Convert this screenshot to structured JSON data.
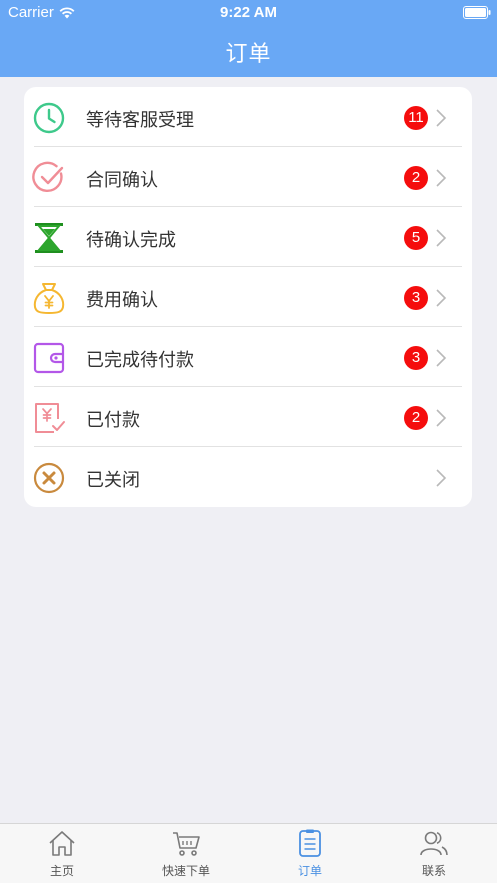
{
  "status_bar": {
    "carrier": "Carrier",
    "time": "9:22 AM"
  },
  "nav": {
    "title": "订单"
  },
  "orders": [
    {
      "label": "等待客服受理",
      "badge": "11",
      "icon": "clock-icon",
      "color": "#3ec98b"
    },
    {
      "label": "合同确认",
      "badge": "2",
      "icon": "check-circle-icon",
      "color": "#f08d96"
    },
    {
      "label": "待确认完成",
      "badge": "5",
      "icon": "hourglass-icon",
      "color": "#2ca52c"
    },
    {
      "label": "费用确认",
      "badge": "3",
      "icon": "money-bag-icon",
      "color": "#f5b731"
    },
    {
      "label": "已完成待付款",
      "badge": "3",
      "icon": "wallet-icon",
      "color": "#b357e8"
    },
    {
      "label": "已付款",
      "badge": "2",
      "icon": "paid-receipt-icon",
      "color": "#f08d96"
    },
    {
      "label": "已关闭",
      "badge": "",
      "icon": "close-circle-icon",
      "color": "#c98a3e"
    }
  ],
  "tabbar": {
    "tabs": [
      {
        "label": "主页",
        "icon": "home-icon"
      },
      {
        "label": "快速下单",
        "icon": "cart-icon"
      },
      {
        "label": "订单",
        "icon": "order-list-icon"
      },
      {
        "label": "联系",
        "icon": "contacts-icon"
      }
    ],
    "active_index": 2
  },
  "colors": {
    "header": "#69a8f5",
    "badge": "#f50d0d",
    "active_tab": "#4a90e2"
  }
}
